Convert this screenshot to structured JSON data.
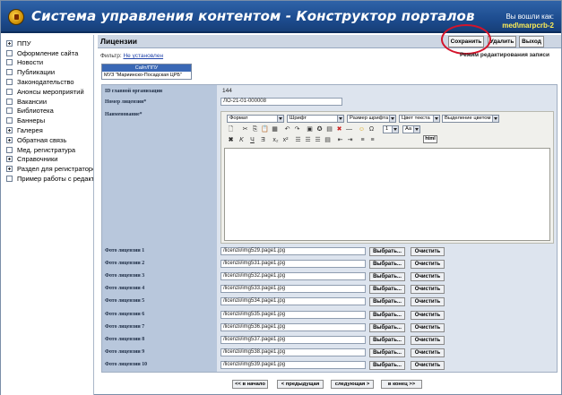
{
  "app": {
    "title": "Система управления контентом - Конструктор порталов",
    "login_label": "Вы вошли как:",
    "login_user": "med\\marpcrb-2"
  },
  "sidebar": {
    "items": [
      {
        "label": "ППУ",
        "expand": true
      },
      {
        "label": "Оформление сайта",
        "expand": false
      },
      {
        "label": "Новости",
        "expand": false
      },
      {
        "label": "Публикации",
        "expand": false
      },
      {
        "label": "Законодательство",
        "expand": false
      },
      {
        "label": "Анонсы мероприятий",
        "expand": false
      },
      {
        "label": "Вакансии",
        "expand": false
      },
      {
        "label": "Библиотека",
        "expand": false
      },
      {
        "label": "Баннеры",
        "expand": false
      },
      {
        "label": "Галерея",
        "expand": true
      },
      {
        "label": "Обратная связь",
        "expand": true
      },
      {
        "label": "Мед. регистратура",
        "expand": false
      },
      {
        "label": "Справочники",
        "expand": true
      },
      {
        "label": "Раздел для регистраторов",
        "expand": true
      },
      {
        "label": "Пример работы с редактором",
        "expand": false
      }
    ]
  },
  "toolbar": {
    "page_title": "Лицензии",
    "save_label": "Сохранить",
    "delete_label": "Удалить",
    "exit_label": "Выход",
    "mode_text": "Режим редактирования записи"
  },
  "filter": {
    "label": "Фильтр:",
    "value": "Не установлен",
    "options": [
      "Сайт/ППУ",
      "МУЗ \"Мариинско-Посадская ЦРБ\""
    ]
  },
  "form": {
    "org_id_label": "ID главной организации",
    "org_id_value": "144",
    "license_number_label": "Номер лицензии",
    "license_number_value": "ЛО-21-01-000008",
    "name_label": "Наименование",
    "required_mark": "*",
    "editor": {
      "format": "Формат",
      "font": "Шрифт",
      "font_size": "Размер шрифта",
      "text_color": "Цвет текста",
      "highlight": "Выделение цветом",
      "size_value": "1",
      "font_value": "Аа",
      "html_label": "html"
    },
    "photos": [
      {
        "label": "Фото лицензии 1",
        "value": "/licenzii/img529.page1.jpg"
      },
      {
        "label": "Фото лицензии 2",
        "value": "/licenzii/img531.page1.jpg"
      },
      {
        "label": "Фото лицензии 3",
        "value": "/licenzii/img532.page1.jpg"
      },
      {
        "label": "Фото лицензии 4",
        "value": "/licenzii/img533.page1.jpg"
      },
      {
        "label": "Фото лицензии 5",
        "value": "/licenzii/img534.page1.jpg"
      },
      {
        "label": "Фото лицензии 6",
        "value": "/licenzii/img535.page1.jpg"
      },
      {
        "label": "Фото лицензии 7",
        "value": "/licenzii/img536.page1.jpg"
      },
      {
        "label": "Фото лицензии 8",
        "value": "/licenzii/img537.page1.jpg"
      },
      {
        "label": "Фото лицензии 9",
        "value": "/licenzii/img538.page1.jpg"
      },
      {
        "label": "Фото лицензии 10",
        "value": "/licenzii/img539.page1.jpg"
      }
    ],
    "choose_label": "Выбрать...",
    "clear_label": "Очистить"
  },
  "pager": {
    "first": "<< в начало",
    "prev": "< предыдущая",
    "next": "следующая >",
    "last": "в конец >>"
  }
}
